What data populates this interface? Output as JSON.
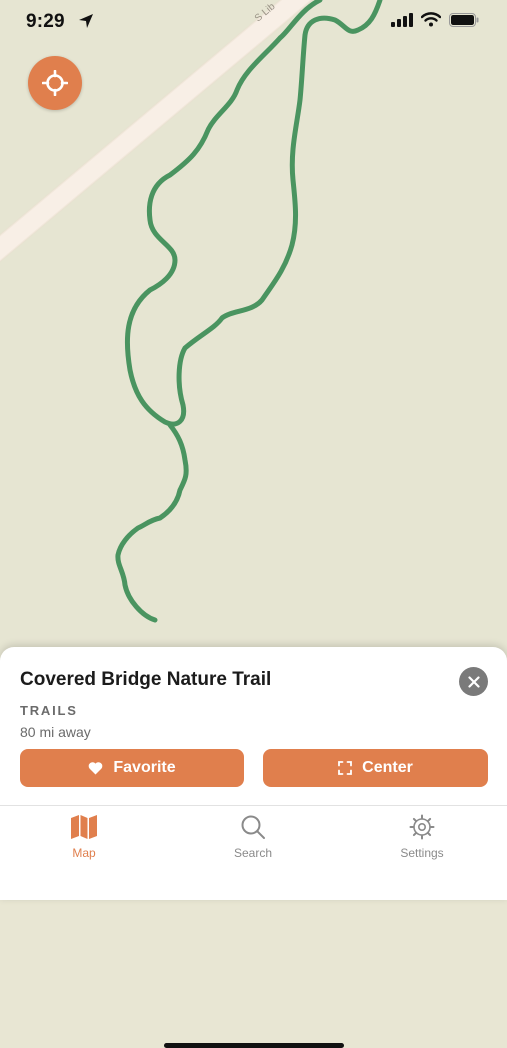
{
  "status_bar": {
    "time": "9:29"
  },
  "map": {
    "road_label": "S Lib",
    "trail_color": "#4a9460",
    "background": "#e6e5d2"
  },
  "detail": {
    "title": "Covered Bridge Nature Trail",
    "category": "TRAILS",
    "distance": "80 mi away",
    "favorite_label": "Favorite",
    "center_label": "Center"
  },
  "tabs": [
    {
      "label": "Map",
      "icon": "map-icon",
      "active": true
    },
    {
      "label": "Search",
      "icon": "magnifier-icon",
      "active": false
    },
    {
      "label": "Settings",
      "icon": "gear-icon",
      "active": false
    }
  ],
  "colors": {
    "accent": "#e07f4d",
    "inactive": "#8a8a8a"
  }
}
